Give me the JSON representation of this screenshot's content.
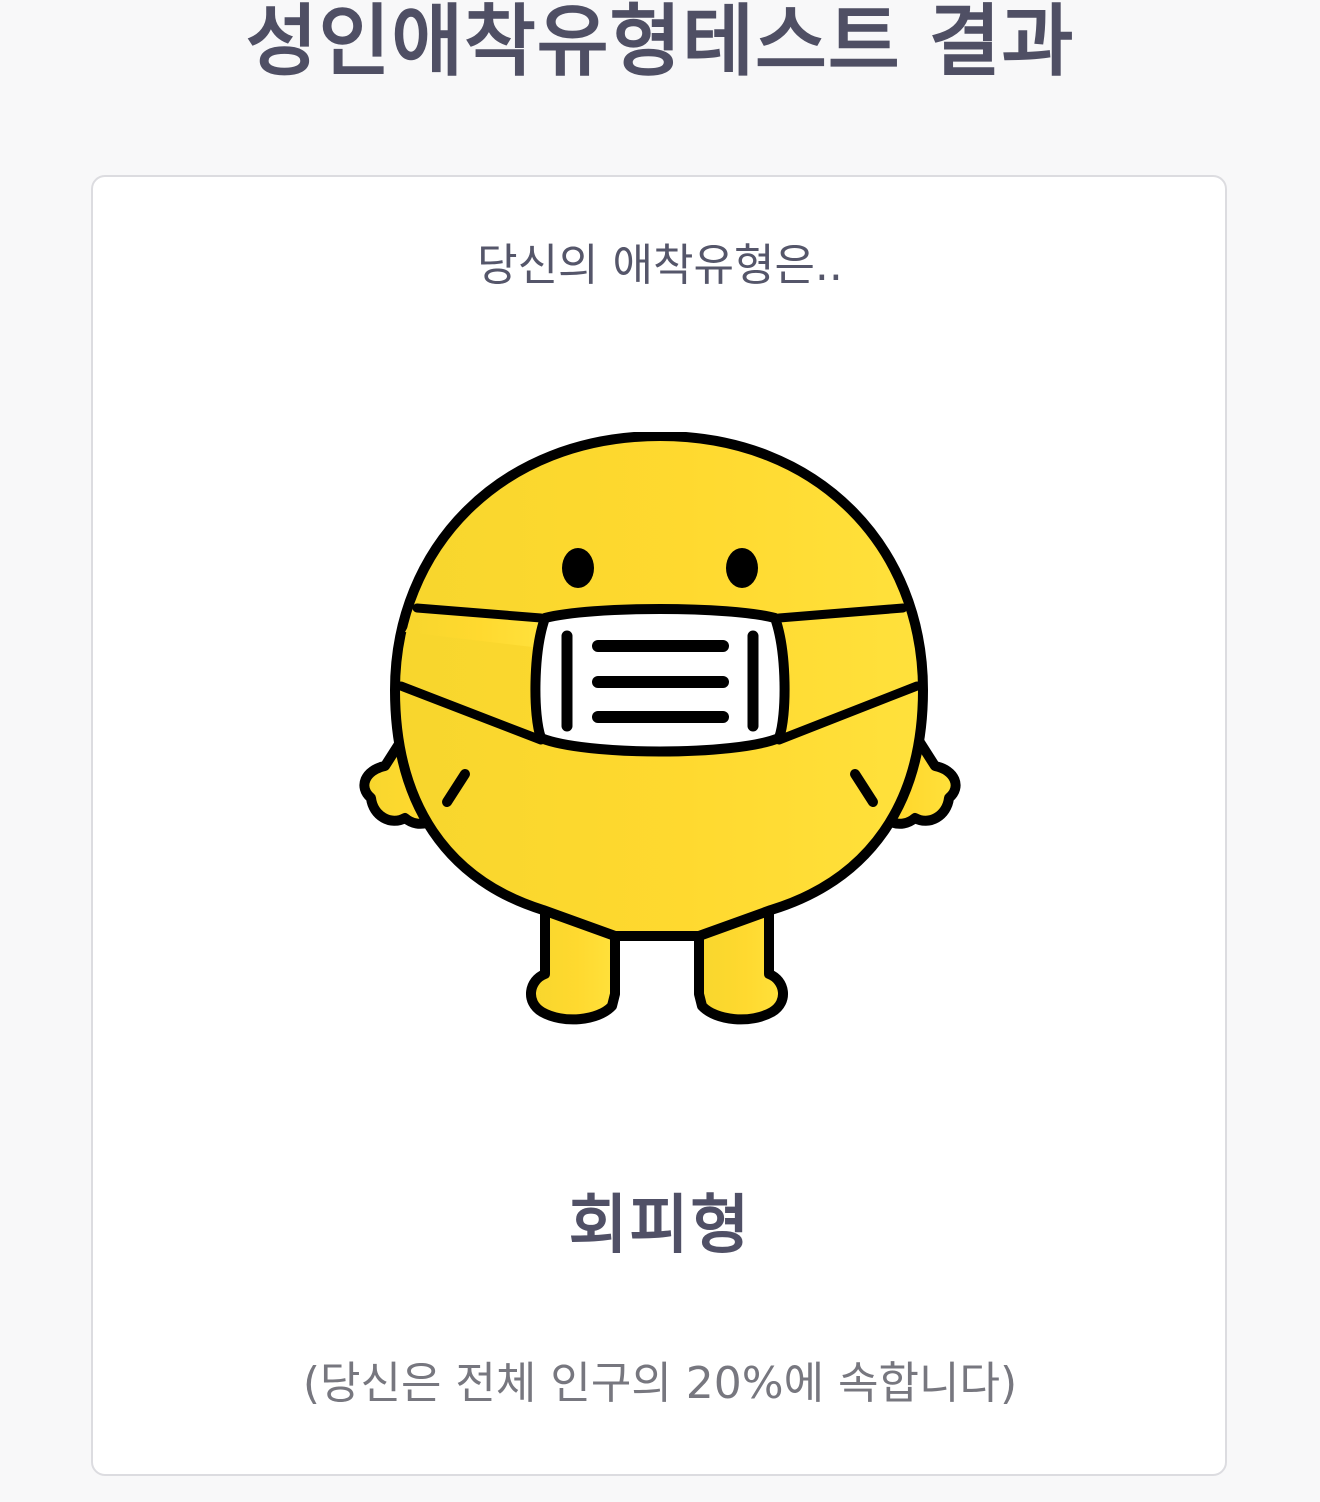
{
  "page": {
    "title": "성인애착유형테스트 결과"
  },
  "result_card": {
    "intro": "당신의 애착유형은..",
    "character_icon": "masked-yellow-character-icon",
    "type_label": "회피형",
    "population_note": "(당신은 전체 인구의 20%에 속합니다)",
    "population_percent": 20
  },
  "colors": {
    "background": "#f8f8f9",
    "card": "#ffffff",
    "card_border": "#dcdce0",
    "title_text": "#4f4f64",
    "body_text": "#55566a",
    "muted_text": "#77777f",
    "character_yellow": "#ffdc35",
    "outline": "#000000"
  }
}
